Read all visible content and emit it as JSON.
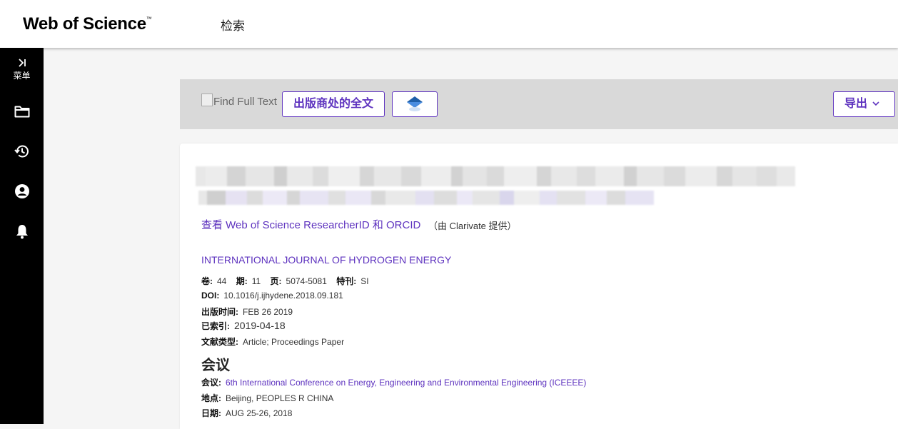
{
  "header": {
    "logo": "Web of Science",
    "logo_tm": "™",
    "nav_search": "检索"
  },
  "sidebar": {
    "menu_label": "菜单"
  },
  "toolbar": {
    "find_full_text": "Find Full Text",
    "publisher_fulltext": "出版商处的全文",
    "export": "导出"
  },
  "record": {
    "researcher_link": "查看 Web of Science ResearcherID 和 ORCID",
    "researcher_note": "（由 Clarivate 提供）",
    "journal": "INTERNATIONAL JOURNAL OF HYDROGEN ENERGY",
    "labels": {
      "volume": "卷:",
      "issue": "期:",
      "pages": "页:",
      "special_issue": "特刊:",
      "doi": "DOI:",
      "published": "出版时间:",
      "indexed": "已索引:",
      "doc_type": "文献类型:",
      "conf_section": "会议",
      "conference": "会议:",
      "location": "地点:",
      "date": "日期:"
    },
    "volume": "44",
    "issue": "11",
    "pages": "5074-5081",
    "special_issue": "SI",
    "doi": "10.1016/j.ijhydene.2018.09.181",
    "published": "FEB 26 2019",
    "indexed": "2019-04-18",
    "doc_type": "Article; Proceedings Paper",
    "conference": "6th International Conference on Energy, Engineering and Environmental Engineering (ICEEEE)",
    "location": "Beijing, PEOPLES R CHINA",
    "date": "AUG 25-26, 2018"
  }
}
